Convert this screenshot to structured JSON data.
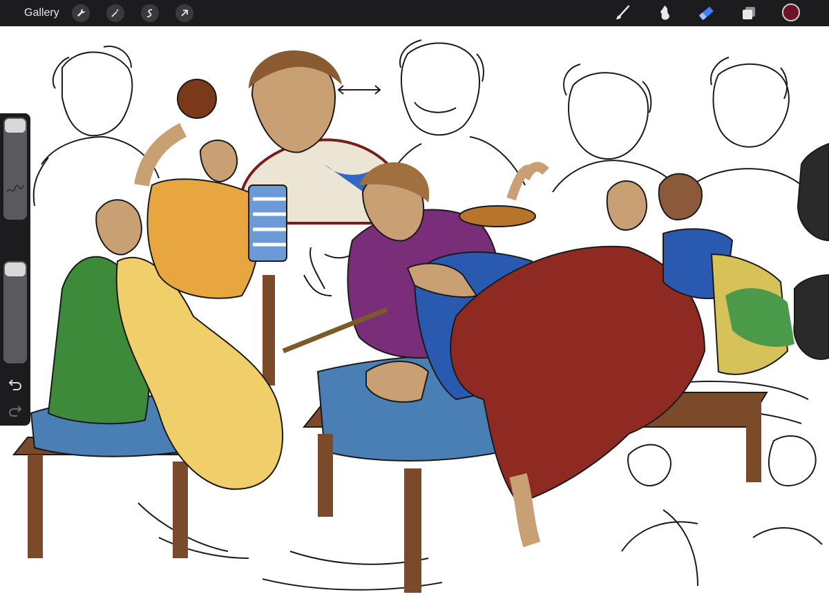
{
  "toolbar": {
    "gallery_label": "Gallery",
    "left_tools": [
      "wrench-icon",
      "magic-wand-icon",
      "selection-icon",
      "transform-arrow-icon"
    ],
    "right_tools": [
      "brush-icon",
      "smudge-icon",
      "eraser-icon",
      "layers-icon"
    ],
    "active_tool": "eraser-icon",
    "accent_color": "#3b82f6",
    "current_color": "#6b1226"
  },
  "sidebar": {
    "controls": [
      "brush-size-slider",
      "modify-button",
      "opacity-slider",
      "undo-icon",
      "redo-icon"
    ]
  },
  "canvas": {
    "colors": {
      "blue_cushion": "#4a7fb5",
      "wood": "#7b4a2a",
      "green_cloak": "#3d8a3a",
      "yellow_robe": "#f0cf6a",
      "orange_tunic": "#e7a640",
      "purple_toga": "#7a2e7a",
      "red_robe": "#8e2a22",
      "skin": "#c99f74",
      "ink": "#1a1a1a"
    }
  }
}
